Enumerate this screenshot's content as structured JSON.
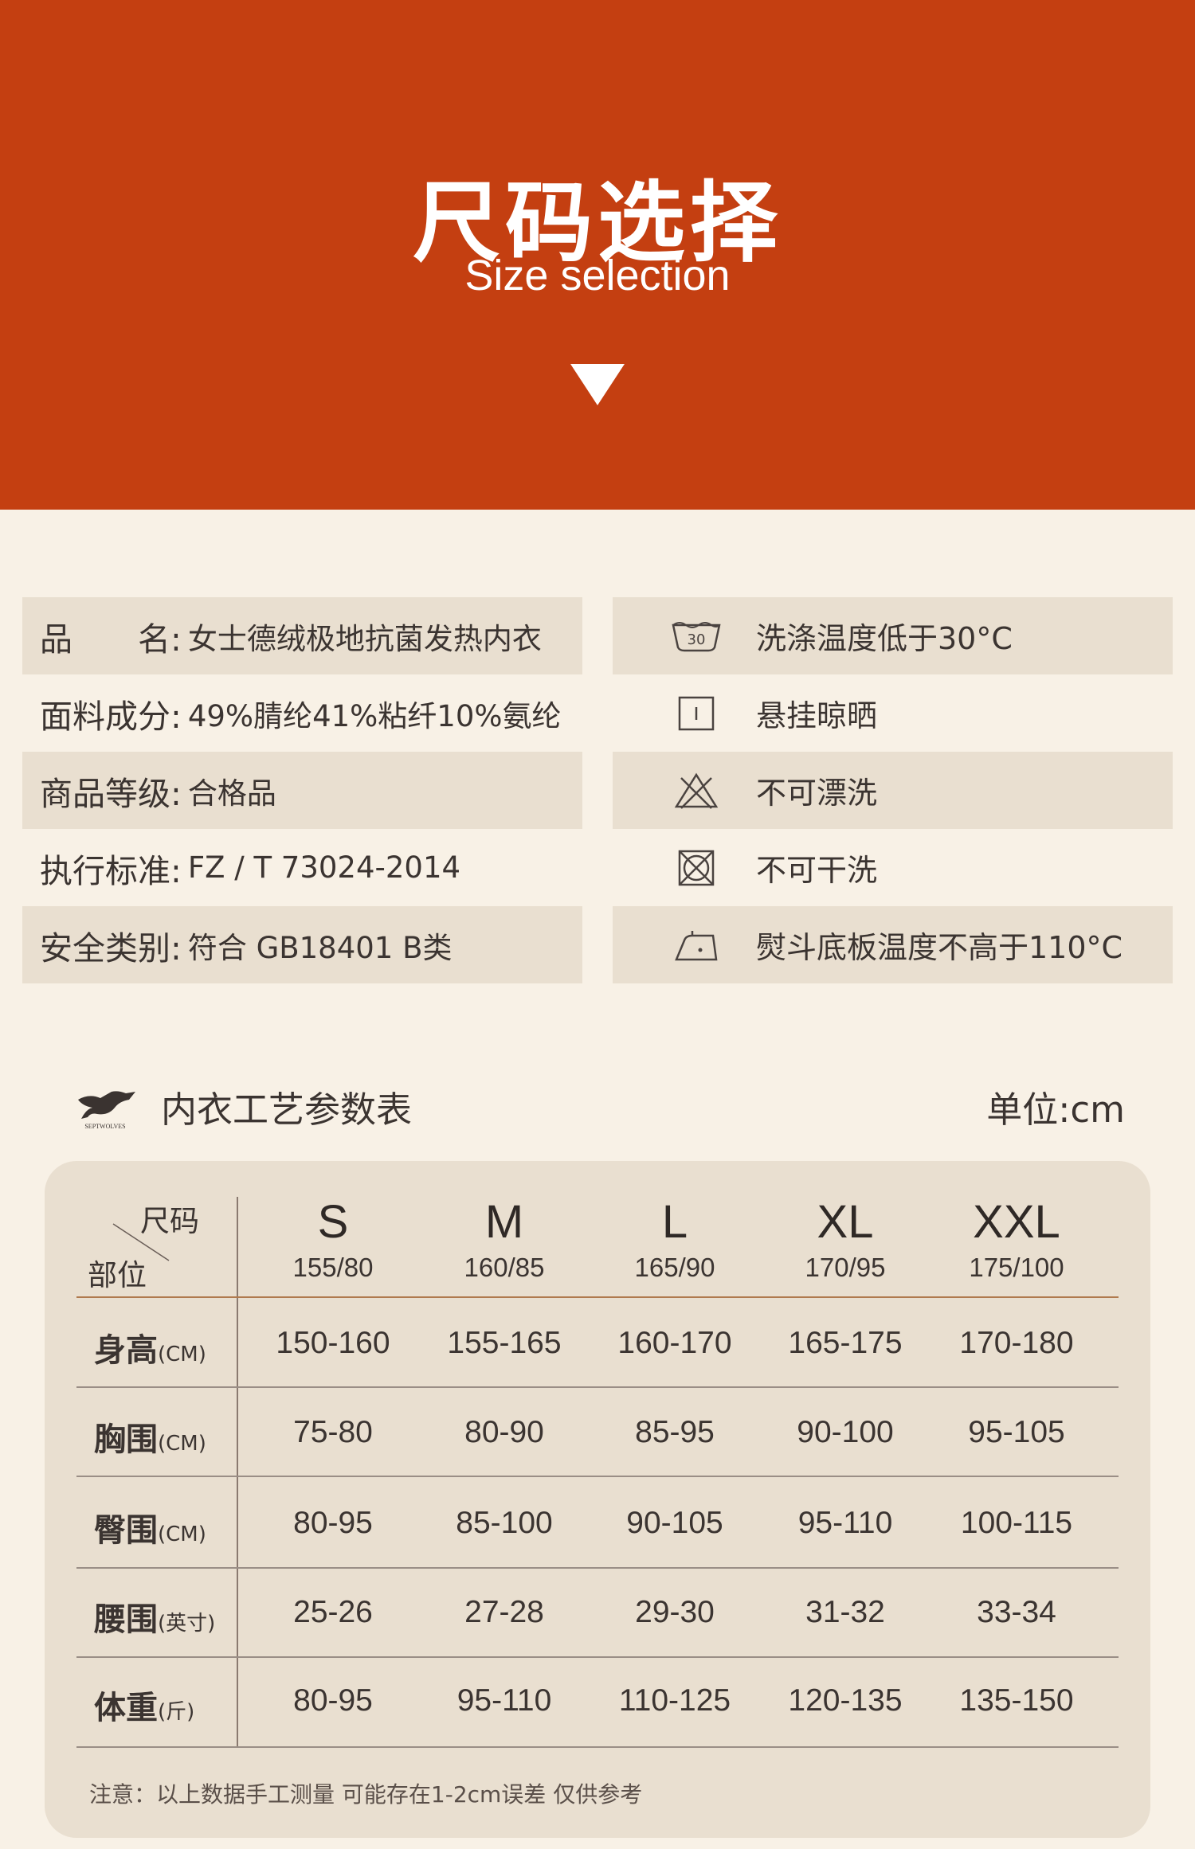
{
  "header": {
    "title": "尺码选择",
    "subtitle": "Size selection"
  },
  "colors": {
    "brand": "#c43f11",
    "background": "#f8f1e6",
    "panel": "#e9dfd0"
  },
  "product_info": [
    {
      "label": "品　　名:",
      "value": "女士德绒极地抗菌发热内衣"
    },
    {
      "label": "面料成分:",
      "value": "49%腈纶41%粘纤10%氨纶"
    },
    {
      "label": "商品等级:",
      "value": "合格品"
    },
    {
      "label": "执行标准:",
      "value": "FZ / T 73024-2014"
    },
    {
      "label": "安全类别:",
      "value": "符合 GB18401 B类"
    }
  ],
  "care_instructions": [
    {
      "icon": "wash-30-icon",
      "icon_text": "30",
      "text": "洗涤温度低于30°C"
    },
    {
      "icon": "hang-dry-icon",
      "text": "悬挂晾晒"
    },
    {
      "icon": "no-bleach-icon",
      "text": "不可漂洗"
    },
    {
      "icon": "no-dry-clean-icon",
      "text": "不可干洗"
    },
    {
      "icon": "iron-low-icon",
      "text": "熨斗底板温度不高于110°C"
    }
  ],
  "size_table": {
    "brand_text": "SEPTWOLVES",
    "title": "内衣工艺参数表",
    "unit": "单位:cm",
    "corner_top": "尺码",
    "corner_bottom": "部位",
    "sizes": [
      {
        "size": "S",
        "spec": "155/80"
      },
      {
        "size": "M",
        "spec": "160/85"
      },
      {
        "size": "L",
        "spec": "165/90"
      },
      {
        "size": "XL",
        "spec": "170/95"
      },
      {
        "size": "XXL",
        "spec": "175/100"
      }
    ],
    "rows": [
      {
        "label": "身高",
        "unit": "(CM)",
        "values": [
          "150-160",
          "155-165",
          "160-170",
          "165-175",
          "170-180"
        ]
      },
      {
        "label": "胸围",
        "unit": "(CM)",
        "values": [
          "75-80",
          "80-90",
          "85-95",
          "90-100",
          "95-105"
        ]
      },
      {
        "label": "臀围",
        "unit": "(CM)",
        "values": [
          "80-95",
          "85-100",
          "90-105",
          "95-110",
          "100-115"
        ]
      },
      {
        "label": "腰围",
        "unit": "(英寸)",
        "values": [
          "25-26",
          "27-28",
          "29-30",
          "31-32",
          "33-34"
        ]
      },
      {
        "label": "体重",
        "unit": "(斤)",
        "values": [
          "80-95",
          "95-110",
          "110-125",
          "120-135",
          "135-150"
        ]
      }
    ],
    "note": "注意：以上数据手工测量 可能存在1-2cm误差 仅供参考"
  }
}
